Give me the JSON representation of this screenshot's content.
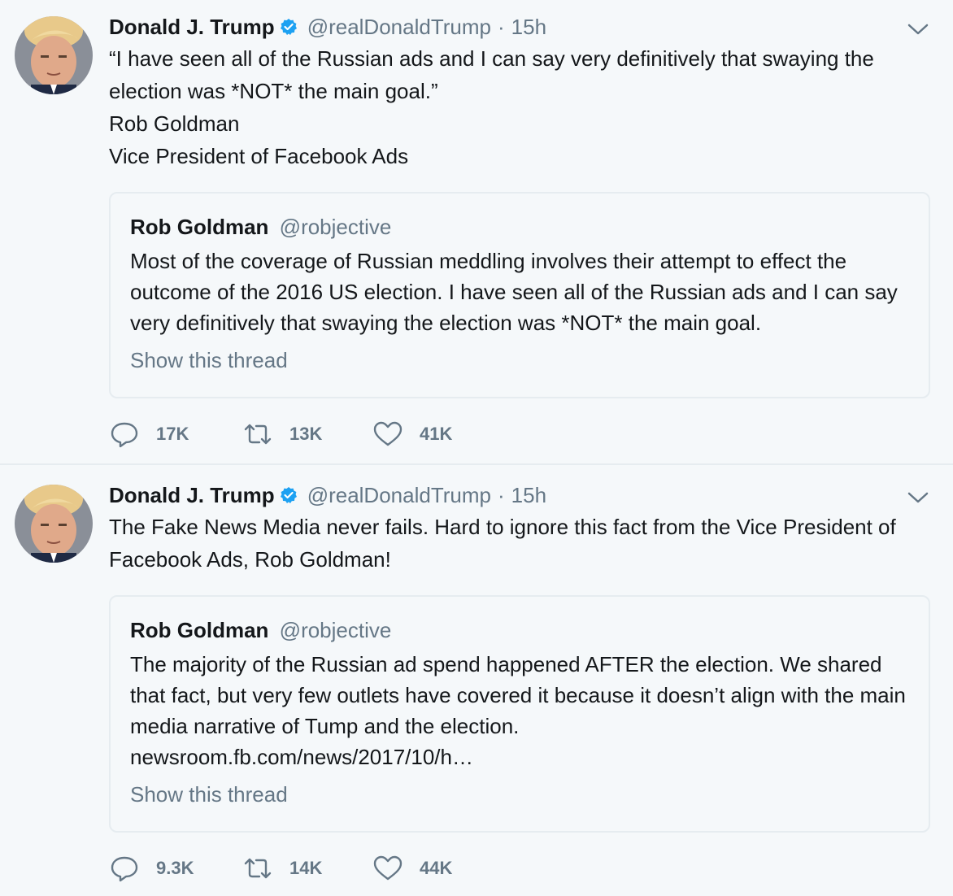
{
  "colors": {
    "background": "#f5f8fa",
    "text": "#14171a",
    "muted": "#657786",
    "verified": "#1da1f2",
    "border": "#e6ecf0"
  },
  "tweets": [
    {
      "author_name": "Donald J. Trump",
      "handle": "@realDonaldTrump",
      "separator": "·",
      "time": "15h",
      "text": "“I have seen all of the Russian ads and I can say very definitively that swaying the election was *NOT* the main goal.”\nRob Goldman\nVice President of Facebook Ads",
      "quote": {
        "author_name": "Rob Goldman",
        "handle": "@robjective",
        "text": "Most of the coverage of Russian meddling involves their attempt to effect the outcome of the 2016 US election.  I have seen all of the Russian ads and I can say very definitively that swaying the election was *NOT* the main goal.",
        "show_thread": "Show this thread"
      },
      "replies": "17K",
      "retweets": "13K",
      "likes": "41K"
    },
    {
      "author_name": "Donald J. Trump",
      "handle": "@realDonaldTrump",
      "separator": "·",
      "time": "15h",
      "text": "The Fake News Media never fails. Hard to ignore this fact from the Vice President of Facebook Ads, Rob Goldman!",
      "quote": {
        "author_name": "Rob Goldman",
        "handle": "@robjective",
        "text": "The majority of the Russian ad spend happened AFTER the election.  We shared that fact, but very few outlets have covered it because it doesn’t align with the main media narrative of Tump and the election.",
        "link": "newsroom.fb.com/news/2017/10/h…",
        "show_thread": "Show this thread"
      },
      "replies": "9.3K",
      "retweets": "14K",
      "likes": "44K"
    }
  ],
  "icons": {
    "verified": "verified-badge-icon",
    "caret": "chevron-down-icon",
    "reply": "reply-bubble-icon",
    "retweet": "retweet-arrows-icon",
    "like": "heart-icon"
  }
}
